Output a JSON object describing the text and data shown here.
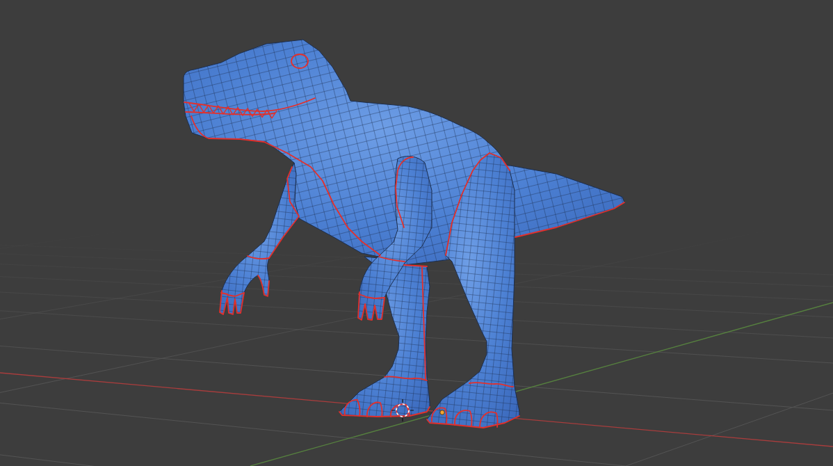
{
  "viewport": {
    "axes": [
      {
        "kind": "x",
        "color": "#a83d3d"
      },
      {
        "kind": "y",
        "color": "#56803f"
      }
    ]
  }
}
